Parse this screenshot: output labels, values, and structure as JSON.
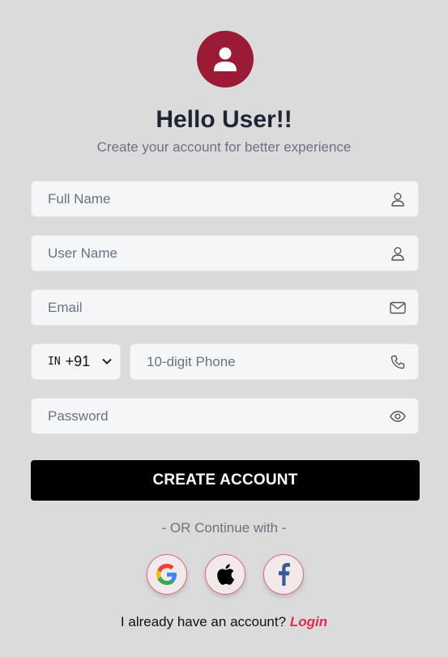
{
  "header": {
    "title": "Hello User!!",
    "subtitle": "Create your account for better experience"
  },
  "form": {
    "full_name": {
      "placeholder": "Full Name",
      "value": ""
    },
    "user_name": {
      "placeholder": "User Name",
      "value": ""
    },
    "email": {
      "placeholder": "Email",
      "value": ""
    },
    "country": {
      "flag": "IN",
      "code": "+91"
    },
    "phone": {
      "placeholder": "10-digit Phone",
      "value": ""
    },
    "password": {
      "placeholder": "Password",
      "value": ""
    },
    "submit_label": "CREATE ACCOUNT"
  },
  "social": {
    "divider_text": "- OR Continue with -",
    "providers": [
      "google-icon",
      "apple-icon",
      "facebook-icon"
    ]
  },
  "footer": {
    "text": "I already have an account?",
    "link_label": "Login"
  },
  "colors": {
    "accent": "#9b1a35",
    "link": "#e8294f",
    "background": "#dcdbdb",
    "button": "#000000"
  }
}
